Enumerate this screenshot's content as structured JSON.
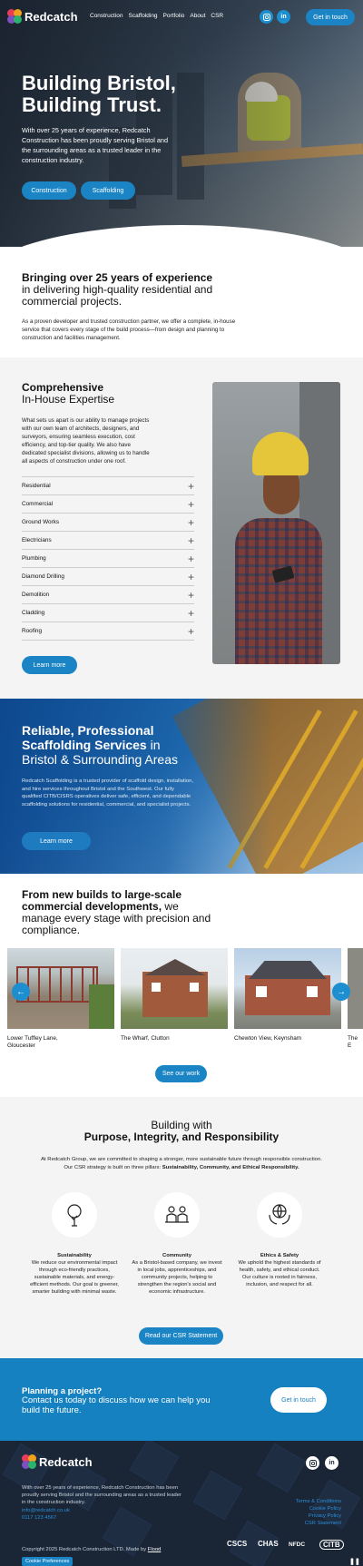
{
  "brand": {
    "name": "Redcatch",
    "accent": "#1a84c4"
  },
  "nav": {
    "links": [
      "Construction",
      "Scaffolding",
      "Portfolio",
      "About",
      "CSR"
    ],
    "get_in_touch": "Get in touch",
    "social": [
      "instagram-icon",
      "linkedin-icon"
    ],
    "social_labels": {
      "linkedin": "in"
    }
  },
  "hero": {
    "title_line1": "Building Bristol,",
    "title_line2": "Building Trust.",
    "text": "With over 25 years of experience, Redcatch Construction has been proudly serving Bristol and the surrounding areas as a trusted leader in the construction industry.",
    "buttons": [
      "Construction",
      "Scaffolding"
    ]
  },
  "intro": {
    "title_bold": "Bringing over 25 years of experience",
    "title_rest": "in delivering high-quality residential and commercial projects.",
    "text": "As a proven developer and trusted construction partner, we offer a complete, in-house service that covers every stage of the build process—from design and planning to construction and facilities management."
  },
  "inhouse": {
    "title_bold": "Comprehensive",
    "title_rest": "In-House Expertise",
    "text": "What sets us apart is our ability to manage projects with our own team of architects, designers, and surveyors, ensuring seamless execution, cost efficiency, and top-tier quality. We also have dedicated specialist divisions, allowing us to handle all aspects of construction under one roof.",
    "items": [
      "Residential",
      "Commercial",
      "Ground Works",
      "Electricians",
      "Plumbing",
      "Diamond Drilling",
      "Demolition",
      "Cladding",
      "Roofing"
    ],
    "learn_more": "Learn more"
  },
  "scaffolding": {
    "title_bold1": "Reliable, Professional",
    "title_bold2": "Scaffolding Services",
    "title_in": "in",
    "title_rest": "Bristol & Surrounding Areas",
    "text": "Redcatch Scaffolding is a trusted provider of scaffold design, installation, and hire services throughout Bristol and the Southwest. Our fully qualified CITB/CISRS operatives deliver safe, efficient, and dependable scaffolding solutions for residential, commercial, and specialist projects.",
    "learn_more": "Learn more"
  },
  "projects": {
    "title_bold1": "From new builds to large-scale",
    "title_bold2": "commercial developments,",
    "title_we": "we",
    "title_rest": "manage every stage with precision and compliance.",
    "items": [
      "Lower Tuffley Lane, Gloucester",
      "The Wharf, Clutton",
      "Chewton View, Keynsham",
      "The E"
    ],
    "see_work": "See our work"
  },
  "csr": {
    "title1": "Building with",
    "title2": "Purpose, Integrity, and Responsibility",
    "intro": "At Redcatch Group, we are committed to shaping a stronger, more sustainable future through responsible construction. Our CSR strategy is built on three pillars:",
    "intro_bold": "Sustainability, Community, and Ethical Responsibility.",
    "pillars": [
      {
        "icon": "tree-icon",
        "title": "Sustainability",
        "text": "We reduce our environmental impact through eco-friendly practices, sustainable materials, and energy-efficient methods. Our goal is greener, smarter building with minimal waste."
      },
      {
        "icon": "people-icon",
        "title": "Community",
        "text": "As a Bristol-based company, we invest in local jobs, apprenticeships, and community projects, helping to strengthen the region's social and economic infrastructure."
      },
      {
        "icon": "globe-hands-icon",
        "title": "Ethics & Safety",
        "text": "We uphold the highest standards of health, safety, and ethical conduct. Our culture is rooted in fairness, inclusion, and respect for all."
      }
    ],
    "button": "Read our CSR Statement"
  },
  "cta": {
    "title": "Planning a project?",
    "text": "Contact us today to discuss how we can help you build the future.",
    "button": "Get in touch"
  },
  "footer": {
    "text": "With over 25 years of experience, Redcatch Construction has been proudly serving Bristol and the surrounding areas as a trusted leader in the construction industry.",
    "email": "info@redcatch.co.uk",
    "phone": "0117 123 4567",
    "links": [
      "Terms & Conditions",
      "Cookie Policy",
      "Privacy Policy",
      "CSR Statement"
    ],
    "copyright": "Copyright 2025 Redcatch Construction LTD. Made by",
    "made_by": "Flood",
    "cookie": "Cookie Preferences",
    "badges": [
      "CSCS",
      "CHAS",
      "NFDC",
      "CITB"
    ]
  }
}
